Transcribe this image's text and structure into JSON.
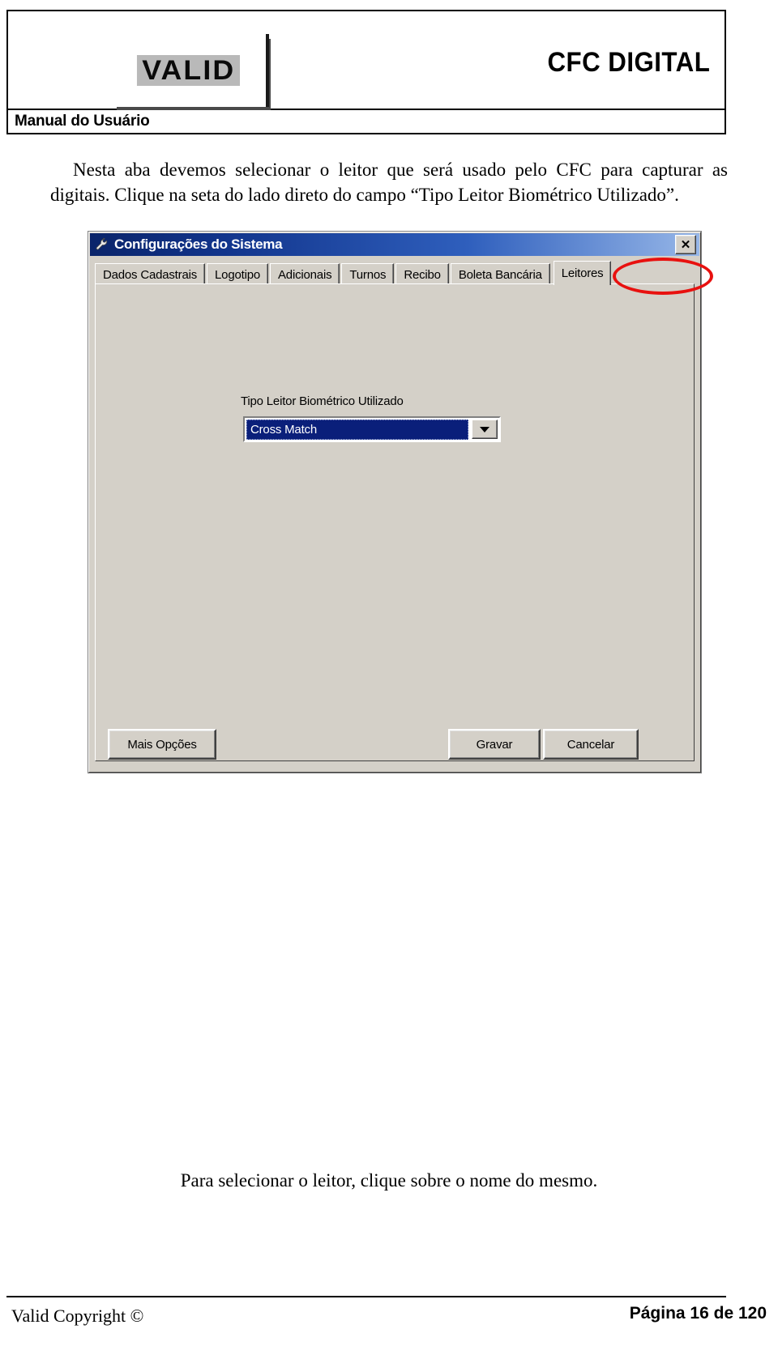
{
  "document": {
    "header": {
      "logo_text": "VALID",
      "brand_title": "CFC DIGITAL",
      "subtitle": "Manual do Usuário"
    },
    "body_paragraph": "Nesta aba devemos selecionar o leitor que será usado pelo CFC para capturar as digitais. Clique na seta do lado direto do campo “Tipo Leitor Biométrico Utilizado”.",
    "bottom_caption": "Para selecionar o leitor, clique sobre o nome do mesmo.",
    "footer": {
      "left": "Valid Copyright ©",
      "right": "Página 16 de 120"
    }
  },
  "dialog": {
    "title": "Configurações do Sistema",
    "title_icon": "wrench-icon",
    "close_label": "✕",
    "tabs": [
      {
        "label": "Dados Cadastrais",
        "selected": false
      },
      {
        "label": "Logotipo",
        "selected": false
      },
      {
        "label": "Adicionais",
        "selected": false
      },
      {
        "label": "Turnos",
        "selected": false
      },
      {
        "label": "Recibo",
        "selected": false
      },
      {
        "label": "Boleta Bancária",
        "selected": false
      },
      {
        "label": "Leitores",
        "selected": true
      }
    ],
    "field": {
      "label": "Tipo Leitor Biométrico Utilizado",
      "value": "Cross Match",
      "arrow_icon": "chevron-down-icon"
    },
    "buttons": {
      "more_options": "Mais Opções",
      "save": "Gravar",
      "cancel": "Cancelar"
    },
    "annotation": {
      "shape": "ellipse",
      "color": "#e8110f",
      "targets_tab": "Leitores"
    }
  },
  "colors": {
    "titlebar_start": "#0a246a",
    "titlebar_end": "#97b7e8",
    "dialog_face": "#d4d0c8",
    "selection_blue": "#0a1f7a",
    "annotation_red": "#e8110f"
  }
}
